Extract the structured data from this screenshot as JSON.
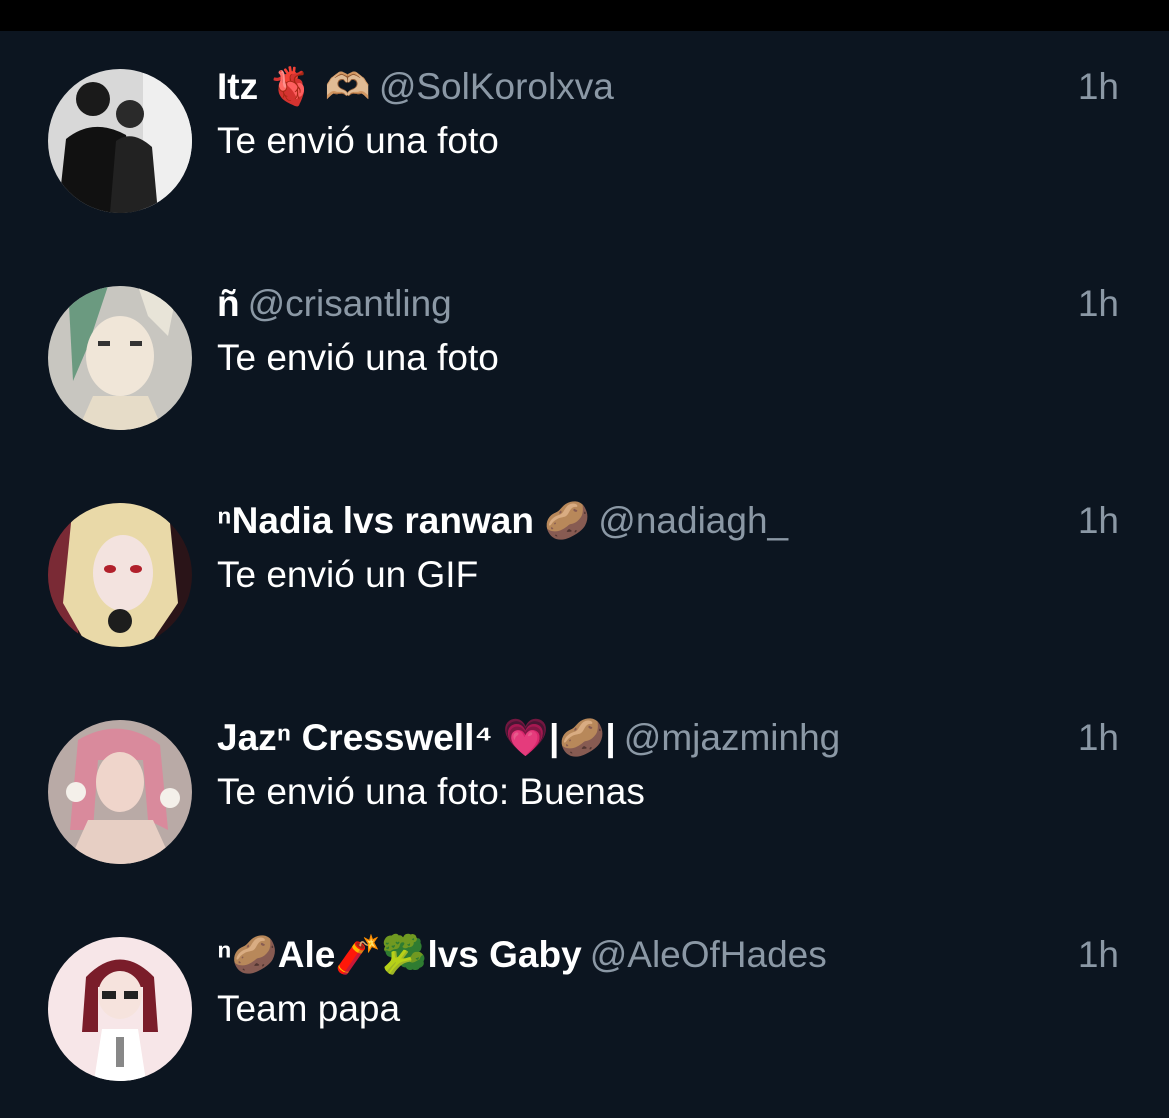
{
  "conversations": [
    {
      "display_name": "Itz 🫀 🫶🏼",
      "handle": "@SolKorolxva",
      "time": "1h",
      "preview": "Te envió una foto"
    },
    {
      "display_name": "ñ",
      "handle": "@crisantling",
      "time": "1h",
      "preview": "Te envió una foto"
    },
    {
      "display_name": "ⁿNadia lvs ranwan 🥔",
      "handle": "@nadiagh_",
      "time": "1h",
      "preview": "Te envió un GIF"
    },
    {
      "display_name": "Jazⁿ Cresswell⁴ 💗|🥔|",
      "handle": "@mjazminhg",
      "time": "1h",
      "preview": "Te envió una foto: Buenas"
    },
    {
      "display_name": "ⁿ🥔Ale🧨🥦lvs Gaby",
      "handle": "@AleOfHades",
      "time": "1h",
      "preview": "Team papa"
    }
  ],
  "colors": {
    "background": "#0c1520",
    "status_bar": "#000000",
    "primary_text": "#ffffff",
    "secondary_text": "#8b98a5"
  }
}
